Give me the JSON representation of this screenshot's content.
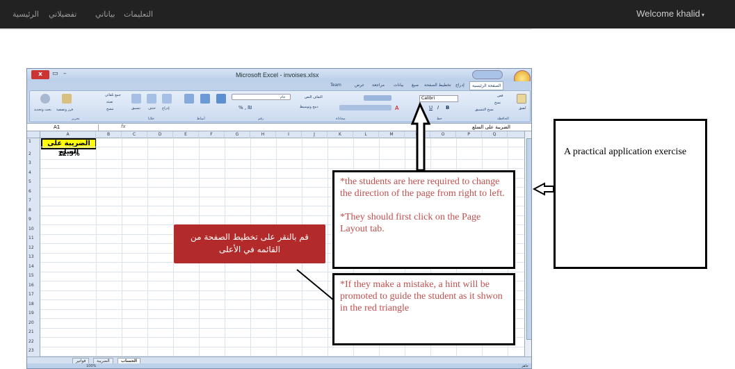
{
  "navbar": {
    "links": [
      "الرئيسية",
      "تفضيلاتي",
      "بياناتي",
      "التعليمات"
    ],
    "welcome": "Welcome khalid"
  },
  "excel": {
    "title": "Microsoft Excel - invoises.xlsx",
    "close_label": "x",
    "tabs": [
      "الصفحة الرئيسية",
      "إدراج",
      "تخطيط الصفحة",
      "صيغ",
      "بيانات",
      "مراجعة",
      "عرض",
      "Team"
    ],
    "font_name": "Calibri",
    "name_box": "A1",
    "fx": "fx",
    "formula_value": "الضريبة على السلع",
    "columns": [
      "A",
      "B",
      "C",
      "D",
      "E",
      "F",
      "G",
      "H",
      "I",
      "J",
      "K",
      "L",
      "M",
      "N",
      "O",
      "P",
      "Q"
    ],
    "rows": [
      "1",
      "2",
      "3",
      "4",
      "5",
      "6",
      "7",
      "8",
      "9",
      "10",
      "11",
      "12",
      "13",
      "14",
      "15",
      "16",
      "17",
      "18",
      "19",
      "20",
      "21",
      "22",
      "23"
    ],
    "cell_a1": "الضريبة على السلع",
    "cell_a2": "12.5%",
    "sheet_tabs": [
      "الحساب",
      "الضريبة",
      "فواتير"
    ],
    "zoom": "100%",
    "status": "جاهز",
    "ribbon": {
      "paste": "لصق",
      "cut": "قص",
      "copy": "نسخ",
      "format_painter": "نسخ التنسيق",
      "clipboard": "الحافظة",
      "font_group": "خط",
      "alignment": "محاذاة",
      "wrap_text": "التفاف النص",
      "merge": "دمج وتوسيط",
      "number": "رقم",
      "general": "عام",
      "styles": "أنماط",
      "cells": "خلايا",
      "insert": "إدراج",
      "delete": "حذف",
      "format": "تنسيق",
      "editing": "تحرير",
      "autosum": "جمع تلقائي",
      "fill": "تعبئة",
      "clear": "مسح",
      "sort_filter": "فرز وتصفية",
      "find_select": "بحث وتحديد"
    }
  },
  "hint": "قم بالنقر على تخطيط الصفحة من القائمه في الأعلى",
  "annotations": {
    "change_line1": "*the students are here required to change the direction of the page from right to left.",
    "change_line2": "*They should first click on the Page Layout tab.",
    "mistake": "*If they make a mistake, a hint will be promoted to guide the student as it shwon in the red triangle",
    "practical": "A practical application exercise"
  },
  "colors": {
    "hint_bg": "#b32a2a",
    "annotation_text": "#c0504d",
    "navbar": "#222222",
    "highlight": "#ffff00"
  }
}
